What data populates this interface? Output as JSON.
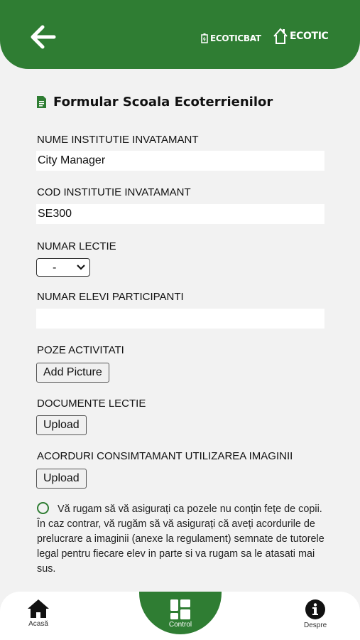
{
  "header": {
    "logo_primary": "ECOTICBAT",
    "logo_secondary": "ECOTIC"
  },
  "form": {
    "title": "Formular Scoala Ecoterrienilor",
    "fields": {
      "institution_name_label": "NUME INSTITUTIE INVATAMANT",
      "institution_name_value": "City Manager",
      "institution_code_label": "COD INSTITUTIE INVATAMANT",
      "institution_code_value": "SE300",
      "lesson_number_label": "NUMAR LECTIE",
      "lesson_number_selected": "-",
      "participants_label": "NUMAR ELEVI PARTICIPANTI",
      "participants_value": "",
      "photos_label": "POZE ACTIVITATI",
      "photos_button": "Add Picture",
      "documents_label": "DOCUMENTE LECTIE",
      "documents_button": "Upload",
      "consent_docs_label": "ACORDURI CONSIMTAMANT UTILIZAREA IMAGINII",
      "consent_docs_button": "Upload"
    },
    "consent_text": "Vă rugam să vă asigurați ca pozele nu conțin fețe de copii. În caz contrar, vă rugăm să vă asigurați că aveți acordurile de prelucrare a imaginii (anexe la regulament) semnate de tutorele legal pentru fiecare elev in parte si va rugam sa le atasati mai sus."
  },
  "bottom_nav": {
    "home_label": "Acasă",
    "control_label": "Control",
    "about_label": "Despre"
  },
  "colors": {
    "brand_green": "#2f7d33",
    "background": "#f2f2f2"
  },
  "icons": {
    "back": "arrow-left-icon",
    "form": "document-icon",
    "home": "home-icon",
    "control": "grid-icon",
    "about": "info-icon"
  }
}
